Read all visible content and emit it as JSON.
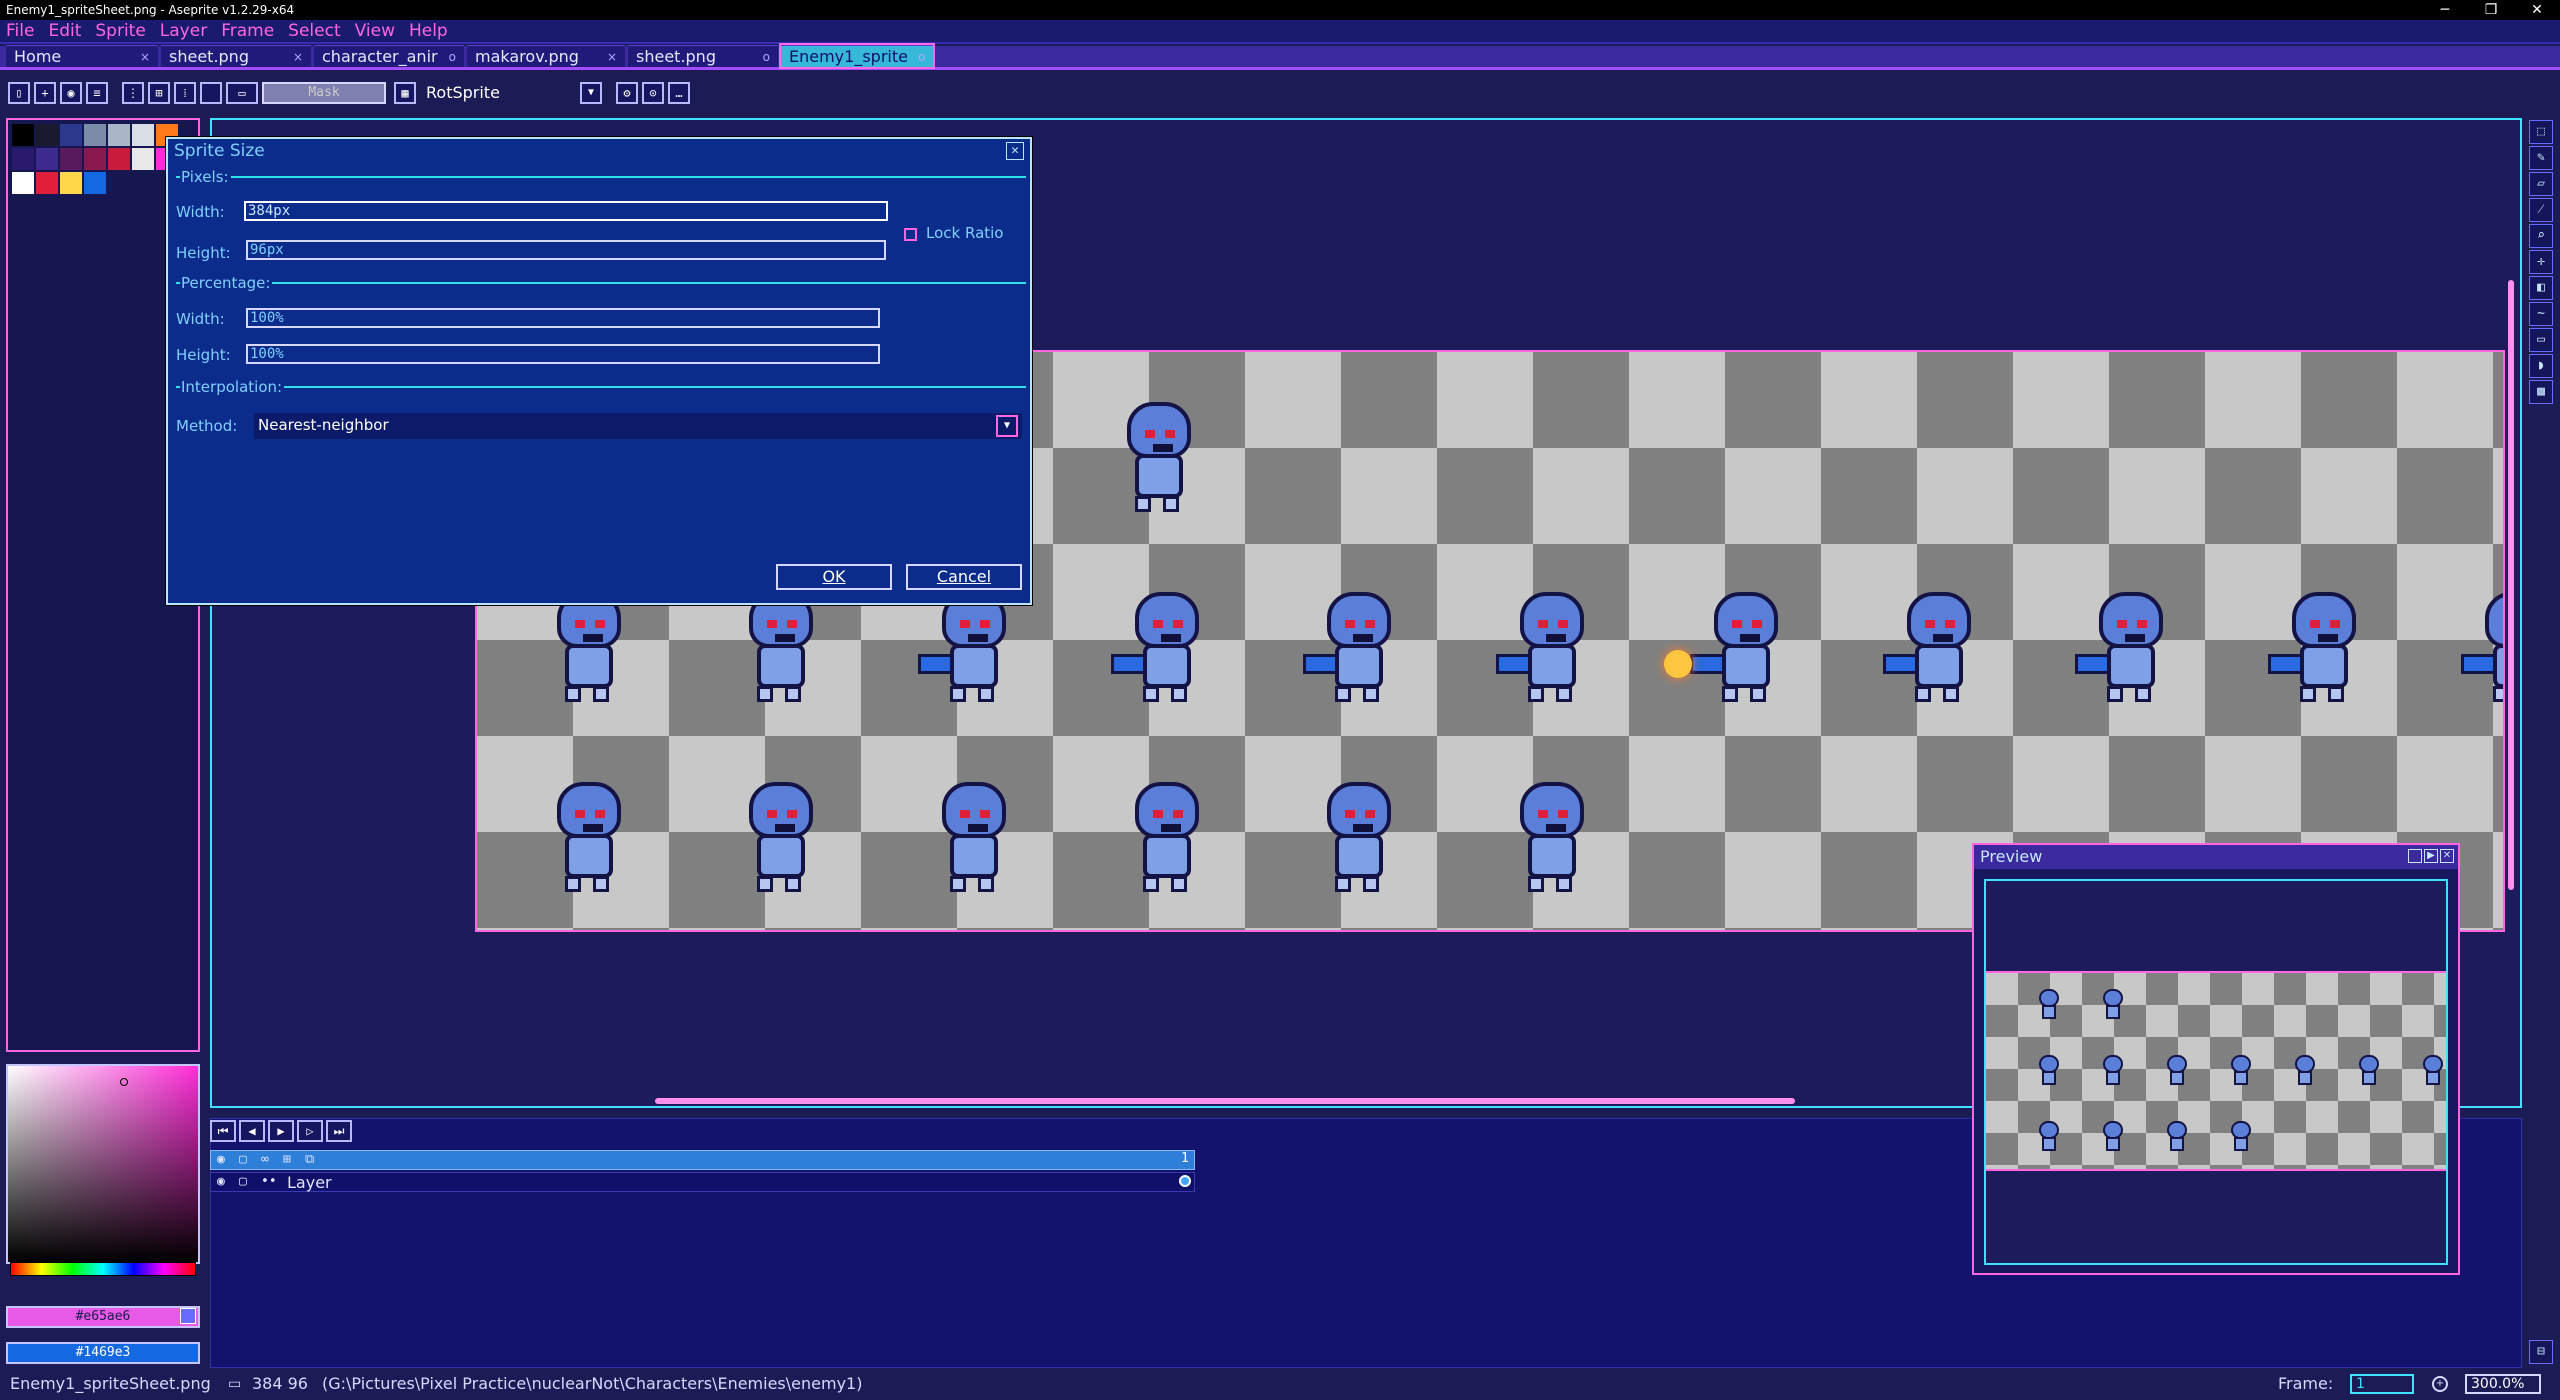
{
  "window": {
    "title": "Enemy1_spriteSheet.png - Aseprite v1.2.29-x64",
    "minimize": "─",
    "maximize": "❐",
    "close": "✕"
  },
  "menu": [
    "File",
    "Edit",
    "Sprite",
    "Layer",
    "Frame",
    "Select",
    "View",
    "Help"
  ],
  "tabs": [
    {
      "label": "Home",
      "close": "×"
    },
    {
      "label": "sheet.png",
      "close": "×"
    },
    {
      "label": "character_anir",
      "close": "o"
    },
    {
      "label": "makarov.png",
      "close": "×"
    },
    {
      "label": "sheet.png",
      "close": "o"
    },
    {
      "label": "Enemy1_sprite",
      "close": "o"
    }
  ],
  "toolbar": {
    "mask_label": "Mask",
    "rotation_algorithm": "RotSprite",
    "dropdown_glyph": "▼"
  },
  "palette": {
    "colors": [
      "#000000",
      "#1a1a2e",
      "#2b3a8c",
      "#7a8ca8",
      "#a9b6c8",
      "#d8dde6",
      "#ff7a1a",
      "#2a1a6e",
      "#3d2a8c",
      "#5a1a5e",
      "#8a1a4e",
      "#c81a3a",
      "#e8e8e8",
      "#ff2cd8",
      "#ffffff",
      "#e0203a",
      "#ffd84a",
      "#1469e3"
    ]
  },
  "colors": {
    "foreground_hex": "#e65ae6",
    "background_hex": "#1469e3"
  },
  "dialog": {
    "title": "Sprite Size",
    "close_glyph": "✕",
    "pixels_section": "Pixels:",
    "width_label": "Width:",
    "width_value": "384px",
    "height_label": "Height:",
    "height_value": "96px",
    "lock_ratio_label": "Lock Ratio",
    "percentage_section": "Percentage:",
    "pct_width_label": "Width:",
    "pct_width_value": "100%",
    "pct_height_label": "Height:",
    "pct_height_value": "100%",
    "interpolation_section": "Interpolation:",
    "method_label": "Method:",
    "method_value": "Nearest-neighbor",
    "ok_label": "OK",
    "cancel_label": "Cancel"
  },
  "timeline": {
    "layer_name": "Layer",
    "frame_number": "1"
  },
  "preview": {
    "title": "Preview"
  },
  "status": {
    "filename": "Enemy1_spriteSheet.png",
    "dimensions": "384 96",
    "path": "(G:\\Pictures\\Pixel Practice\\nuclearNot\\Characters\\Enemies\\enemy1)",
    "frame_label": "Frame:",
    "frame_value": "1",
    "zoom": "300.0%"
  }
}
